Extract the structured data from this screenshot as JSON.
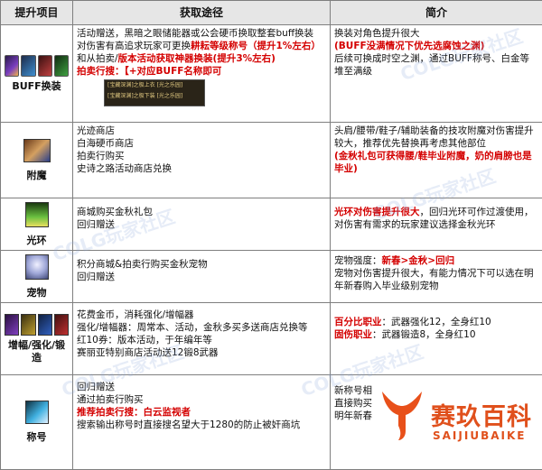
{
  "headers": [
    "提升项目",
    "获取途径",
    "简介"
  ],
  "rows": [
    {
      "name": "BUFF换装",
      "get": [
        {
          "t": "活动赠送，黑暗之眼储能器或公会硬币换取整套buff换装",
          "red": false
        },
        {
          "t": "对伤害有高追求玩家可更换",
          "red": false,
          "tail": "耕耘等级称号（提升1%左右）",
          "tail_red": true
        },
        {
          "t": "和从拍卖/",
          "red": false,
          "tail": "版本活动获取神器换装(提升3%左右)",
          "tail_red": true
        },
        {
          "t": "拍卖行搜：【+对应BUFF名称即可",
          "red": true
        }
      ],
      "screenshot_lines": [
        "[宝藏深渊]之极上衣  [光之乐园]",
        "[宝藏深渊]之极下装  [光之乐园]"
      ],
      "intro": [
        {
          "t": "换装对角色提升很大",
          "red": false
        },
        {
          "t": "(BUFF没满情况下优先选腐蚀之渊)",
          "red": true
        },
        {
          "t": "后续可换成时空之渊，通过BUFF称号、白金等堆至满级",
          "red": false
        }
      ]
    },
    {
      "name": "附魔",
      "get": [
        {
          "t": "光迹商店",
          "red": false
        },
        {
          "t": "白海硬币商店",
          "red": false
        },
        {
          "t": "拍卖行购买",
          "red": false
        },
        {
          "t": "史诗之路活动商店兑换",
          "red": false
        }
      ],
      "intro": [
        {
          "t": "头肩/腰带/鞋子/辅助装备的技攻附魔对伤害提升较大，推荐优先替换再考虑其他部位",
          "red": false
        },
        {
          "t": "(金秋礼包可获得腰/鞋毕业附魔，奶的肩膀也是毕业)",
          "red": true
        }
      ]
    },
    {
      "name": "光环",
      "get": [
        {
          "t": "商城购买金秋礼包",
          "red": false
        },
        {
          "t": "回归赠送",
          "red": false
        }
      ],
      "intro": [
        {
          "t": "光环对伤害提升很大",
          "red": true,
          "tail": "，回归光环可作过渡使用，对伤害有需求的玩家建议选择金秋光环",
          "tail_red": false
        }
      ]
    },
    {
      "name": "宠物",
      "get": [
        {
          "t": "积分商城&拍卖行购买金秋宠物",
          "red": false
        },
        {
          "t": "回归赠送",
          "red": false
        }
      ],
      "intro": [
        {
          "t": "宠物强度：",
          "red": false,
          "tail": "新春>金秋>回归",
          "tail_red": true
        },
        {
          "t": "宠物对伤害提升很大，有能力情况下可以选在明年新春购入毕业级别宠物",
          "red": false
        }
      ]
    },
    {
      "name": "增幅/强化/锻造",
      "get": [
        {
          "t": "花费金币，消耗强化/增幅器",
          "red": false
        },
        {
          "t": "强化/增幅器：周常本、活动，金秋多买多送商店兑换等",
          "red": false
        },
        {
          "t": "红10券：版本活动，于年编年等",
          "red": false
        },
        {
          "t": "赛丽亚特别商店活动送12锻8武器",
          "red": false
        }
      ],
      "intro": [
        {
          "t": "百分比职业",
          "red": true,
          "tail": "：武器强化12，全身红10",
          "tail_red": false
        },
        {
          "t": "固伤职业",
          "red": true,
          "tail": "：武器锻造8，全身红10",
          "tail_red": false
        }
      ]
    },
    {
      "name": "称号",
      "get": [
        {
          "t": "回归赠送",
          "red": false
        },
        {
          "t": "通过拍卖行购买",
          "red": false
        },
        {
          "t": "推荐拍卖行搜：白云监视者",
          "red": true
        },
        {
          "t": "搜索输出称号时直接搜名望大于1280的防止被奸商坑",
          "red": false
        }
      ],
      "intro": [
        {
          "t": "新称号相",
          "red": false
        },
        {
          "t": "直接购买",
          "red": false
        },
        {
          "t": "明年新春",
          "red": false
        }
      ]
    }
  ],
  "watermark": "COLG玩家社区",
  "logo": {
    "cn": "赛玖百科",
    "en": "SAIJIUBAIKE"
  }
}
